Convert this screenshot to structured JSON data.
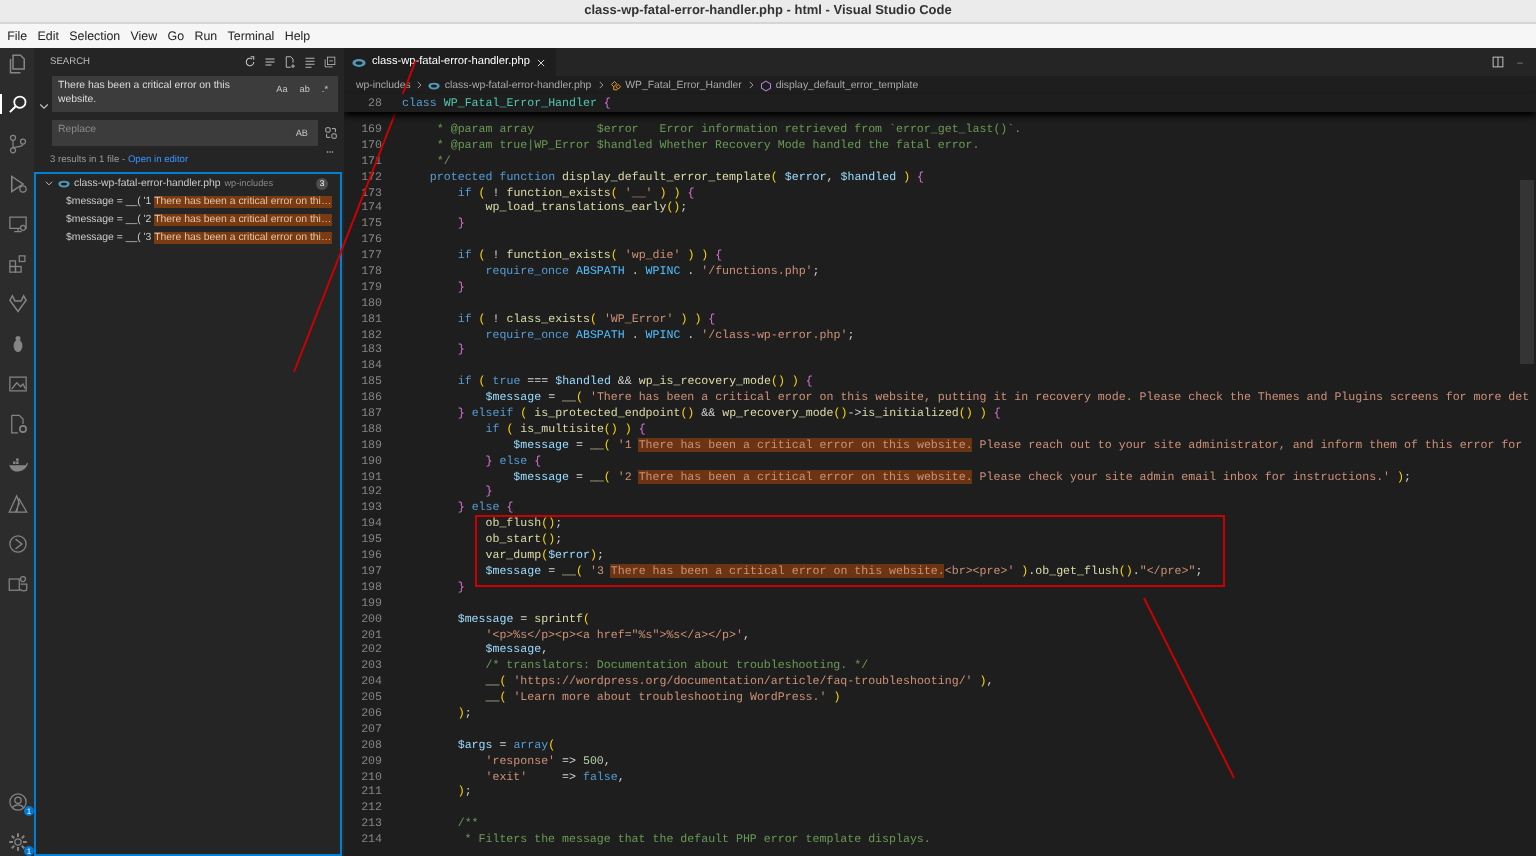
{
  "window": {
    "title": "class-wp-fatal-error-handler.php - html - Visual Studio Code"
  },
  "menu_bar": [
    "File",
    "Edit",
    "Selection",
    "View",
    "Go",
    "Run",
    "Terminal",
    "Help"
  ],
  "activity_bar": {
    "items": [
      {
        "kind": "explorer",
        "selected": false
      },
      {
        "kind": "search",
        "selected": true
      },
      {
        "kind": "source-control",
        "selected": false
      },
      {
        "kind": "run",
        "selected": false
      },
      {
        "kind": "remote",
        "selected": false
      },
      {
        "kind": "extensions",
        "selected": false
      },
      {
        "kind": "fox",
        "selected": false
      },
      {
        "kind": "bug",
        "selected": false
      },
      {
        "kind": "image",
        "selected": false
      },
      {
        "kind": "file-gear",
        "selected": false
      },
      {
        "kind": "whale",
        "selected": false
      },
      {
        "kind": "triangle",
        "selected": false
      },
      {
        "kind": "compass",
        "selected": false
      },
      {
        "kind": "people",
        "selected": false
      }
    ],
    "bottom": [
      {
        "kind": "account",
        "badge": "1"
      },
      {
        "kind": "settings",
        "badge": "1"
      }
    ]
  },
  "sidebar": {
    "title": "SEARCH",
    "search": {
      "value": "There has been a critical error on this website.",
      "options": [
        {
          "label": "Aa",
          "on": false
        },
        {
          "label": "ab",
          "on": false
        },
        {
          "label": ".*",
          "on": false
        }
      ]
    },
    "replace": {
      "placeholder": "Replace",
      "option": {
        "label": "AB",
        "on": false
      }
    },
    "summary": "3 results in 1 file - ",
    "open_in_editor": "Open in editor",
    "results": [
      {
        "file": "class-wp-fatal-error-handler.php",
        "folder": "wp-includes",
        "count": "3",
        "expanded": true,
        "matches": [
          {
            "prefix": "$message = __( '1 ",
            "match": "There has been a critical error on thi…"
          },
          {
            "prefix": "$message = __( '2 ",
            "match": "There has been a critical error on thi…"
          },
          {
            "prefix": "$message = __( '3 ",
            "match": "There has been a critical error on thi…"
          }
        ]
      }
    ]
  },
  "editor": {
    "tab": {
      "label": "class-wp-fatal-error-handler.php",
      "selected": true
    },
    "breadcrumbs": [
      {
        "kind": "folder",
        "label": "wp-includes"
      },
      {
        "kind": "php",
        "label": "class-wp-fatal-error-handler.php"
      },
      {
        "kind": "class",
        "label": "WP_Fatal_Error_Handler"
      },
      {
        "kind": "method",
        "label": "display_default_error_template"
      }
    ],
    "sticky": {
      "number": "28",
      "text": "class WP_Fatal_Error_Handler {"
    },
    "lines": [
      {
        "number": "169",
        "text": "     * @param array         $error   Error information retrieved from `error_get_last()`."
      },
      {
        "number": "170",
        "text": "     * @param true|WP_Error $handled Whether Recovery Mode handled the fatal error."
      },
      {
        "number": "171",
        "text": "     */"
      },
      {
        "number": "172",
        "text": "    protected function display_default_error_template( $error, $handled ) {"
      },
      {
        "number": "173",
        "text": "        if ( ! function_exists( '__' ) ) {"
      },
      {
        "number": "174",
        "text": "            wp_load_translations_early();"
      },
      {
        "number": "175",
        "text": "        }"
      },
      {
        "number": "176"
      },
      {
        "number": "177",
        "text": "        if ( ! function_exists( 'wp_die' ) ) {"
      },
      {
        "number": "178",
        "text": "            require_once ABSPATH . WPINC . '/functions.php';"
      },
      {
        "number": "179",
        "text": "        }"
      },
      {
        "number": "180"
      },
      {
        "number": "181",
        "text": "        if ( ! class_exists( 'WP_Error' ) ) {"
      },
      {
        "number": "182",
        "text": "            require_once ABSPATH . WPINC . '/class-wp-error.php';"
      },
      {
        "number": "183",
        "text": "        }"
      },
      {
        "number": "184"
      },
      {
        "number": "185",
        "text": "        if ( true === $handled && wp_is_recovery_mode() ) {"
      },
      {
        "number": "186",
        "text": "            $message = __( 'There has been a critical error on this website, putting it in recovery mode. Please check the Themes and Plugins screens for more det"
      },
      {
        "number": "187",
        "text": "        } elseif ( is_protected_endpoint() && wp_recovery_mode()->is_initialized() ) {"
      },
      {
        "number": "188",
        "text": "            if ( is_multisite() ) {"
      },
      {
        "number": "189",
        "segments": [
          {
            "text": "                $message = __( '1 ",
            "match": false
          },
          {
            "text": "There has been a critical error on this website.",
            "match": true
          },
          {
            "text": " Please reach out to your site administrator, and inform them of this error for",
            "match": false
          }
        ]
      },
      {
        "number": "190",
        "text": "            } else {"
      },
      {
        "number": "191",
        "segments": [
          {
            "text": "                $message = __( '2 ",
            "match": false
          },
          {
            "text": "There has been a critical error on this website.",
            "match": true
          },
          {
            "text": " Please check your site admin email inbox for instructions.' );",
            "match": false
          }
        ]
      },
      {
        "number": "192",
        "text": "            }"
      },
      {
        "number": "193",
        "text": "        } else {"
      },
      {
        "number": "194",
        "text": "            ob_flush();"
      },
      {
        "number": "195",
        "text": "            ob_start();"
      },
      {
        "number": "196",
        "text": "            var_dump($error);"
      },
      {
        "number": "197",
        "segments": [
          {
            "text": "            $message = __( '3 ",
            "match": false
          },
          {
            "text": "There has been a critical error on this website.",
            "match": true
          },
          {
            "text": "<br><pre>' ).ob_get_flush().\"</pre>\";",
            "match": false
          }
        ]
      },
      {
        "number": "198",
        "text": "        }"
      },
      {
        "number": "199"
      },
      {
        "number": "200",
        "text": "        $message = sprintf("
      },
      {
        "number": "201",
        "text": "            '<p>%s</p><p><a href=\"%s\">%s</a></p>',"
      },
      {
        "number": "202",
        "text": "            $message,"
      },
      {
        "number": "203",
        "text": "            /* translators: Documentation about troubleshooting. */"
      },
      {
        "number": "204",
        "text": "            __( 'https://wordpress.org/documentation/article/faq-troubleshooting/' ),"
      },
      {
        "number": "205",
        "text": "            __( 'Learn more about troubleshooting WordPress.' )"
      },
      {
        "number": "206",
        "text": "        );"
      },
      {
        "number": "207"
      },
      {
        "number": "208",
        "text": "        $args = array("
      },
      {
        "number": "209",
        "text": "            'response' => 500,"
      },
      {
        "number": "210",
        "text": "            'exit'     => false,"
      },
      {
        "number": "211",
        "text": "        );"
      },
      {
        "number": "212"
      },
      {
        "number": "213",
        "text": "        /**"
      },
      {
        "number": "214",
        "text": "         * Filters the message that the default PHP error template displays."
      }
    ]
  }
}
